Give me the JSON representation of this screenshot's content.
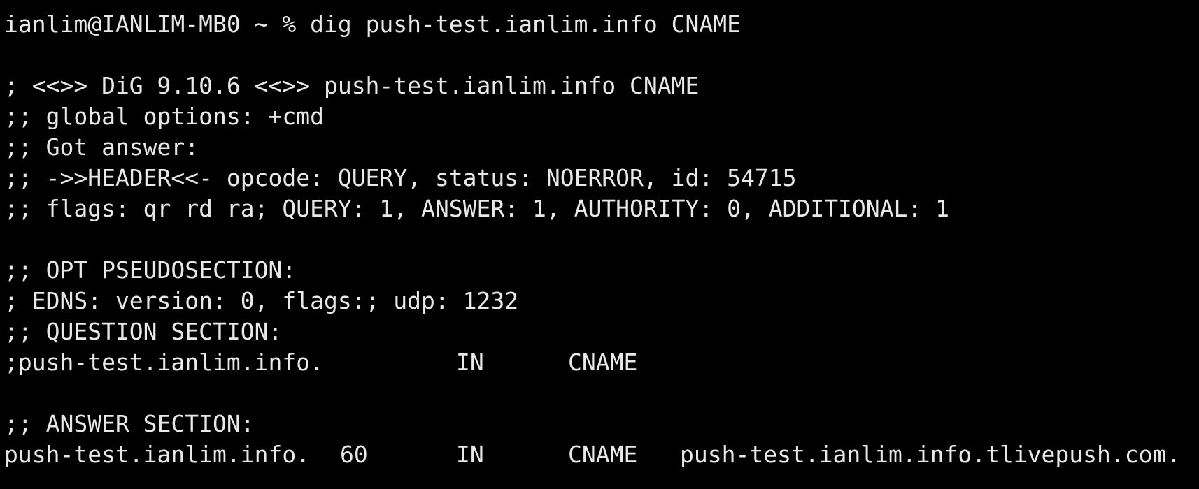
{
  "terminal": {
    "prompt": "ianlim@IANLIM-MB0 ~ % ",
    "command": "dig push-test.ianlim.info CNAME",
    "banner": "; <<>> DiG 9.10.6 <<>> push-test.ianlim.info CNAME",
    "global_options": ";; global options: +cmd",
    "got_answer": ";; Got answer:",
    "header": ";; ->>HEADER<<- opcode: QUERY, status: NOERROR, id: 54715",
    "flags": ";; flags: qr rd ra; QUERY: 1, ANSWER: 1, AUTHORITY: 0, ADDITIONAL: 1",
    "opt_section": ";; OPT PSEUDOSECTION:",
    "edns": "; EDNS: version: 0, flags:; udp: 1232",
    "question_section": ";; QUESTION SECTION:",
    "question": {
      "name": ";push-test.ianlim.info.",
      "class": "IN",
      "type": "CNAME"
    },
    "answer_section": ";; ANSWER SECTION:",
    "answer": {
      "name": "push-test.ianlim.info.",
      "ttl": "60",
      "class": "IN",
      "type": "CNAME",
      "target": "push-test.ianlim.info.tlivepush.com."
    },
    "colors": {
      "background": "#000000",
      "text": "#e8e8e8"
    }
  }
}
